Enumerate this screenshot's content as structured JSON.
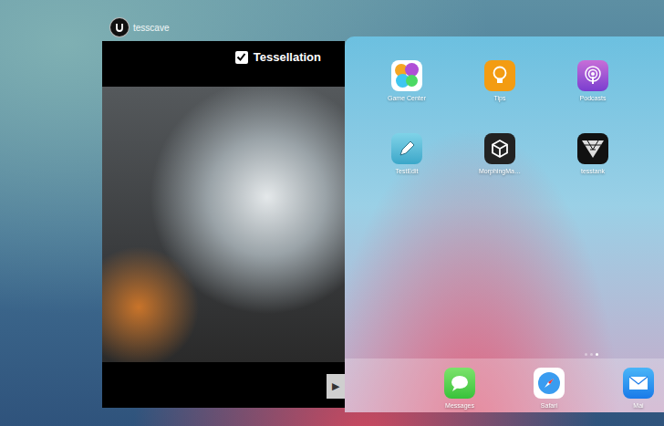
{
  "app_switcher": {
    "game_window": {
      "app_name": "tesscave",
      "checkbox": {
        "label": "Tessellation",
        "checked": true
      },
      "play_button": "▶"
    },
    "home_screen": {
      "apps": [
        {
          "label": "Game Center",
          "kind": "gamecenter"
        },
        {
          "label": "Tips",
          "kind": "tips"
        },
        {
          "label": "Podcasts",
          "kind": "podcasts"
        },
        {
          "label": "TestEdit",
          "kind": "testedit"
        },
        {
          "label": "MorphingMa…",
          "kind": "unity"
        },
        {
          "label": "tesstank",
          "kind": "tesstank"
        }
      ],
      "page_dots": [
        {
          "selected": false
        },
        {
          "selected": false
        },
        {
          "selected": true
        }
      ],
      "dock": [
        {
          "label": "Messages",
          "kind": "messages"
        },
        {
          "label": "Safari",
          "kind": "safari"
        },
        {
          "label": "Mai",
          "kind": "mail"
        }
      ]
    }
  }
}
